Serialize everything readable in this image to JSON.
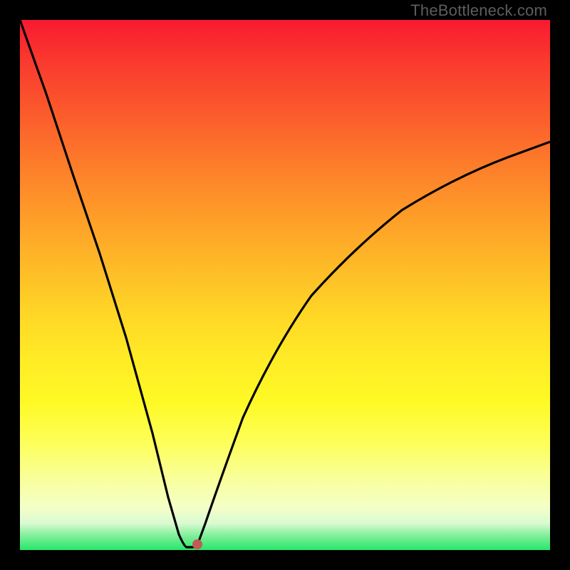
{
  "watermark": "TheBottleneck.com",
  "chart_data": {
    "type": "line",
    "title": "",
    "xlabel": "",
    "ylabel": "",
    "xlim": [
      0,
      100
    ],
    "ylim": [
      0,
      100
    ],
    "series": [
      {
        "name": "bottleneck-curve",
        "x": [
          0,
          5,
          10,
          15,
          20,
          25,
          28,
          30,
          31.5,
          32.5,
          33.5,
          35,
          38,
          42,
          48,
          55,
          63,
          72,
          82,
          92,
          100
        ],
        "values": [
          100,
          86,
          71,
          56,
          40,
          22,
          10,
          3,
          0,
          0,
          1,
          5,
          14,
          25,
          38,
          48,
          57,
          64,
          70,
          74,
          77
        ]
      }
    ],
    "marker": {
      "x": 33.5,
      "y_percent_from_top": 98.9
    },
    "gradient_stops": [
      {
        "pct": 0,
        "color": "#f81a30"
      },
      {
        "pct": 100,
        "color": "#27e66a"
      }
    ]
  }
}
